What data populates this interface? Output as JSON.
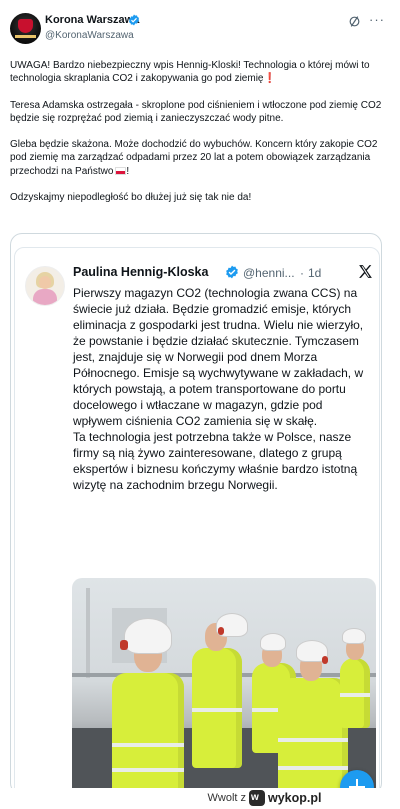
{
  "post": {
    "author_name": "Korona Warszawa",
    "handle": "@KoronaWarszawa",
    "paragraphs": [
      "UWAGA! Bardzo niebezpieczny wpis Hennig-Kloski! Technologia o której mówi to technologia skraplania CO2 i zakopywania go pod ziemię",
      "Teresa Adamska ostrzegała - skroplone pod ciśnieniem i wtłoczone pod ziemię CO2 będzie się rozprężać pod ziemią i zanieczyszczać wody pitne.",
      "Gleba będzie skażona. Może dochodzić do wybuchów. Koncern który zakopie CO2 pod ziemię ma zarządzać odpadami przez 20 lat a potem obowiązek zarządzania przechodzi na Państwo",
      "Odzyskajmy niepodległość bo dłużej już się tak nie da!"
    ],
    "exclaim_glyph": "❗",
    "end_exclaim": "!",
    "more_glyph": "···"
  },
  "quote": {
    "author_name": "Paulina Hennig-Kloska",
    "handle": "@henni...",
    "separator": "·",
    "time": "1d",
    "paragraphs": [
      "Pierwszy magazyn CO2 (technologia zwana CCS) na świecie już działa. Będzie gromadzić emisje, których eliminacja z gospodarki jest trudna. Wielu nie wierzyło, że powstanie i będzie działać skutecznie. Tymczasem jest, znajduje się w Norwegii pod dnem Morza Północnego. Emisje są wychwytywane w zakładach, w których powstają, a potem transportowane do portu docelowego i wtłaczane w magazyn, gdzie pod wpływem ciśnienia CO2 zamienia się w skałę.",
      "Ta technologia jest potrzebna także w Polsce, nasze firmy są nią żywo zainteresowane, dlatego z grupą ekspertów i biznesu kończymy właśnie bardzo istotną wizytę na zachodnim brzegu Norwegii."
    ]
  },
  "footer": {
    "author": "Wwolt z",
    "site": "wykop.pl",
    "logo_letter": "w"
  },
  "colors": {
    "verified": "#1d9bf0",
    "text": "#0f1419",
    "secondary": "#536471",
    "hivis": "#d7ee3a"
  },
  "icons": [
    "verified-badge-icon",
    "grok-icon",
    "more-icon",
    "x-logo-icon",
    "compose-plus-icon",
    "wykop-logo-icon"
  ]
}
